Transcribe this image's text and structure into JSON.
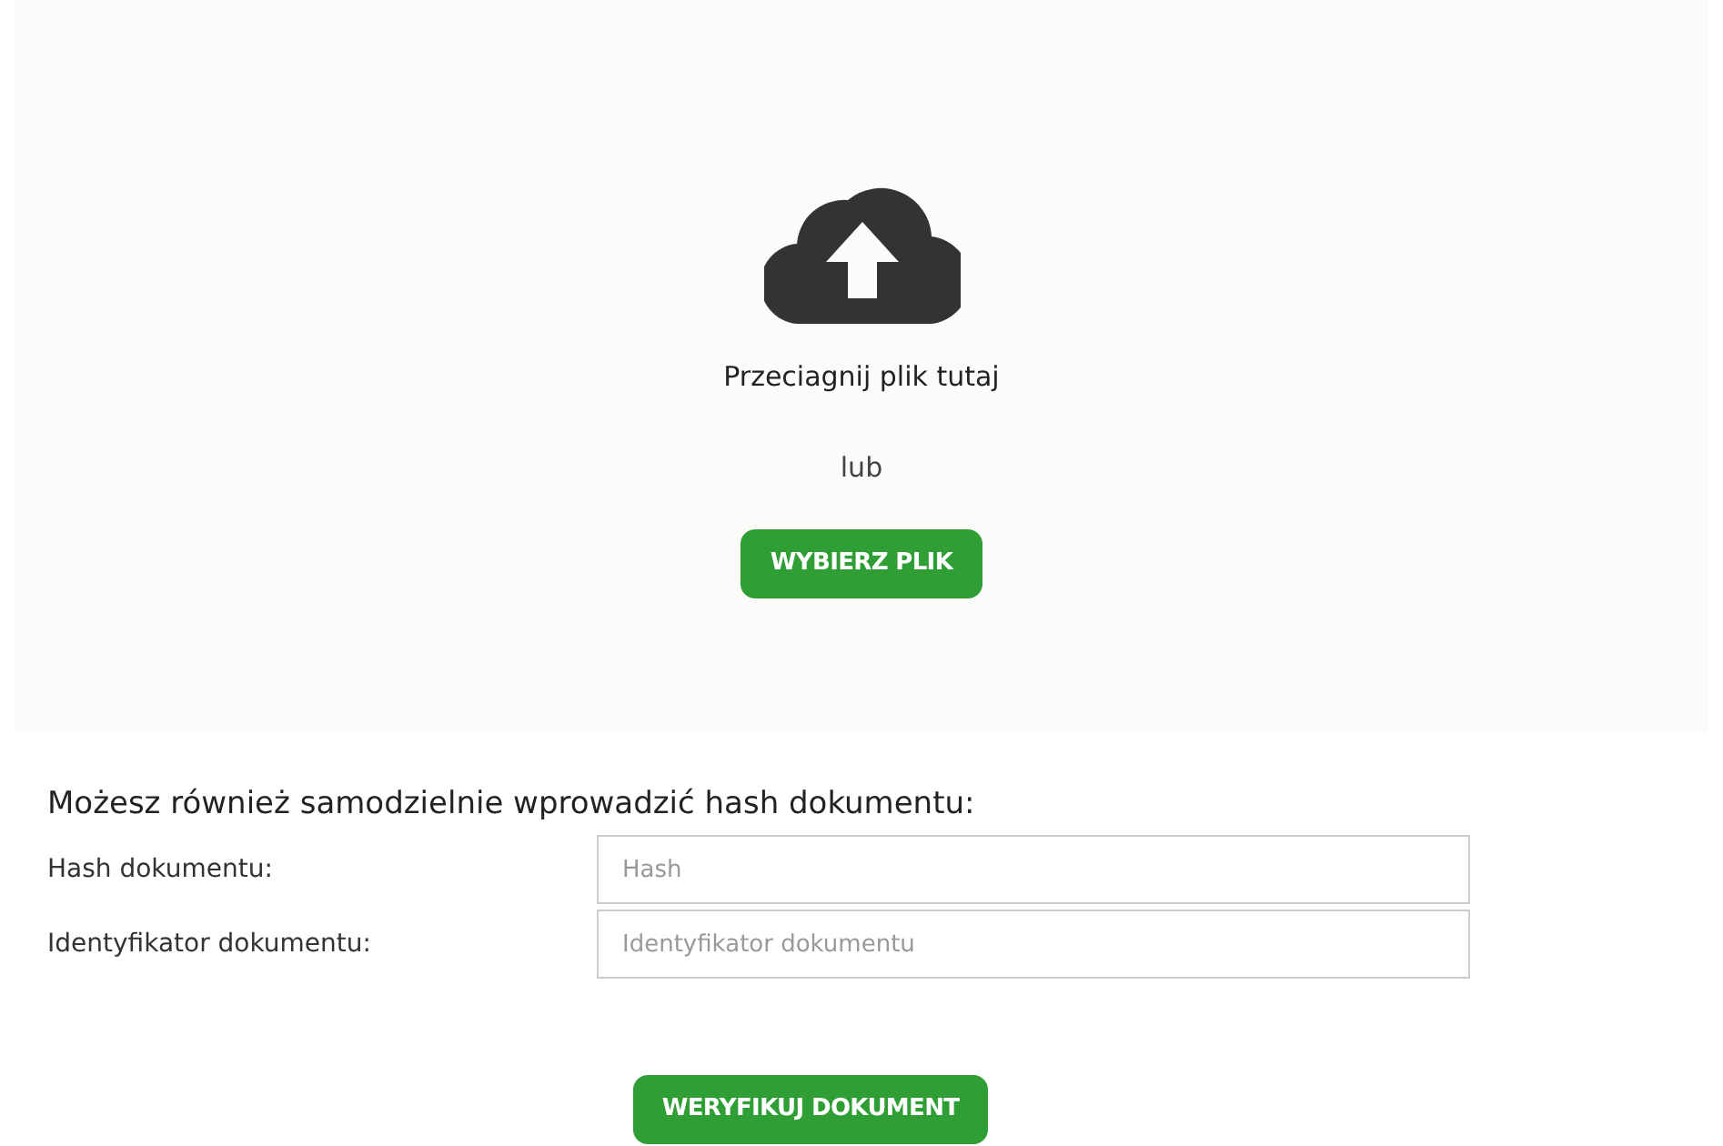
{
  "dropzone": {
    "prompt": "Przeciagnij plik tutaj",
    "or": "lub",
    "button": "WYBIERZ PLIK"
  },
  "manual": {
    "heading": "Możesz również samodzielnie wprowadzić hash dokumentu:",
    "fields": [
      {
        "label": "Hash dokumentu:",
        "placeholder": "Hash"
      },
      {
        "label": "Identyfikator dokumentu:",
        "placeholder": "Identyfikator dokumentu"
      }
    ],
    "button": "WERYFIKUJ DOKUMENT"
  }
}
